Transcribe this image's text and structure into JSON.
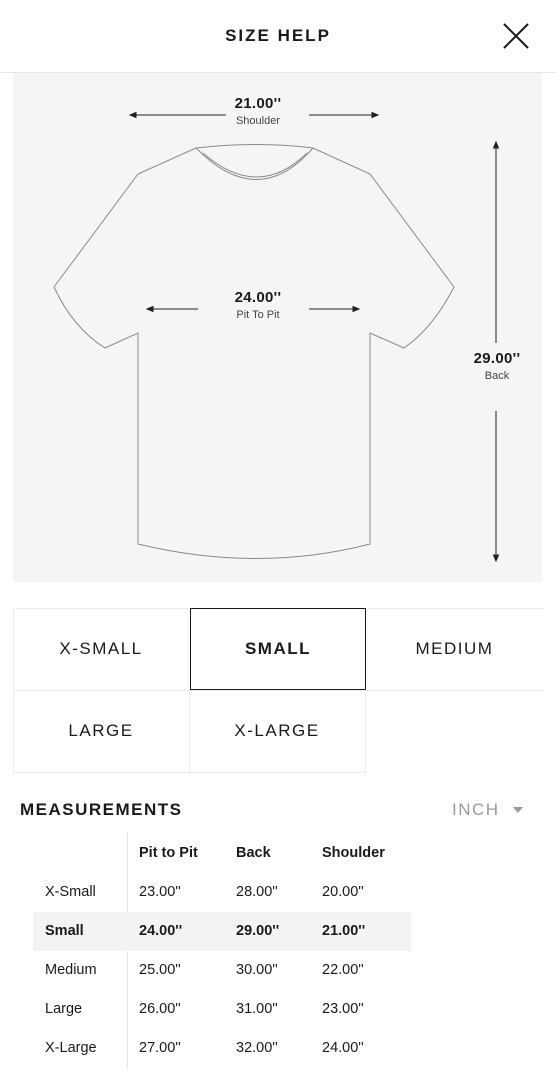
{
  "header": {
    "title": "SIZE HELP",
    "close_icon": "close-icon"
  },
  "diagram": {
    "shoulder": {
      "value": "21.00''",
      "label": "Shoulder"
    },
    "pit_to_pit": {
      "value": "24.00''",
      "label": "Pit To Pit"
    },
    "back": {
      "value": "29.00''",
      "label": "Back"
    }
  },
  "sizes": [
    "X-SMALL",
    "SMALL",
    "MEDIUM",
    "LARGE",
    "X-LARGE"
  ],
  "selected_size": "SMALL",
  "measurements": {
    "title": "MEASUREMENTS",
    "unit": "INCH",
    "columns": [
      "Pit to Pit",
      "Back",
      "Shoulder"
    ],
    "rows": [
      {
        "size": "X-Small",
        "pit": "23.00''",
        "back": "28.00''",
        "shoulder": "20.00''"
      },
      {
        "size": "Small",
        "pit": "24.00''",
        "back": "29.00''",
        "shoulder": "21.00''"
      },
      {
        "size": "Medium",
        "pit": "25.00''",
        "back": "30.00''",
        "shoulder": "22.00''"
      },
      {
        "size": "Large",
        "pit": "26.00''",
        "back": "31.00''",
        "shoulder": "23.00''"
      },
      {
        "size": "X-Large",
        "pit": "27.00''",
        "back": "32.00''",
        "shoulder": "24.00''"
      }
    ]
  }
}
